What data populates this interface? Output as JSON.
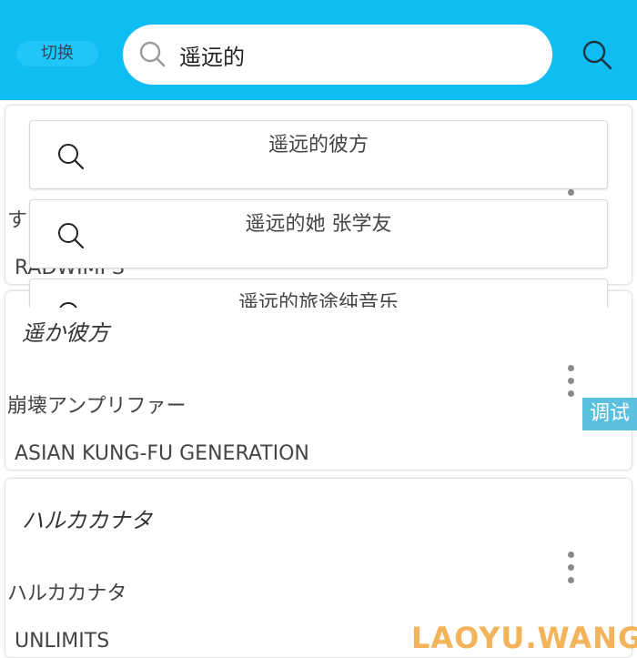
{
  "header": {
    "switch_label": "切换",
    "search_value": "遥远的",
    "colors": {
      "bar": "#0fbdf3",
      "button": "#1ec6fa"
    }
  },
  "suggestions": [
    {
      "label": "遥远的彼方"
    },
    {
      "label": "遥远的她 张学友"
    },
    {
      "label": "遥远的旅途纯音乐"
    }
  ],
  "results": [
    {
      "title": "",
      "song": "す",
      "artist": "RADWIMPS"
    },
    {
      "title": "遥か彼方",
      "song": "崩壊アンプリファー",
      "artist": "ASIAN KUNG-FU GENERATION"
    },
    {
      "title": "ハルカカナタ",
      "song": "ハルカカナタ",
      "artist": "UNLIMITS"
    }
  ],
  "debug_tag": "调试",
  "watermark": "LAOYU.WANG",
  "icons": [
    "search-icon",
    "more-vertical-icon"
  ]
}
